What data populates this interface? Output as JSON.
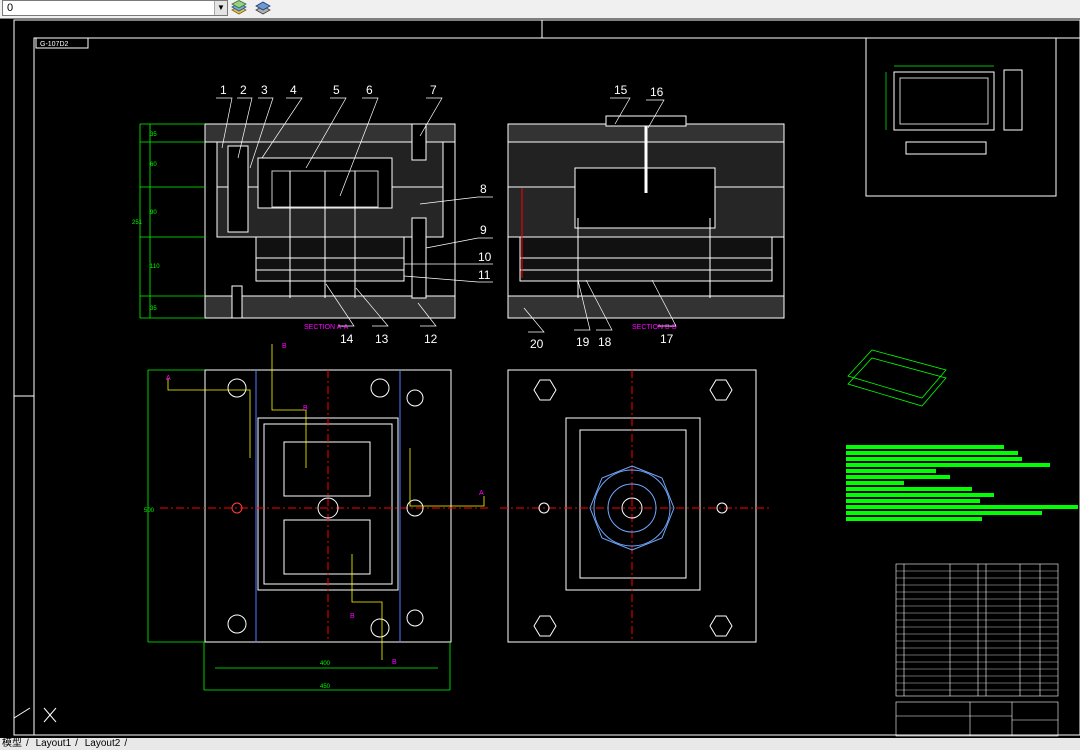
{
  "toolbar": {
    "layer_value": "0",
    "dropdown_arrow": "▼",
    "icons": [
      "layer-states-icon",
      "layer-properties-icon"
    ]
  },
  "drawing": {
    "drawing_number": "G-107D2",
    "section_aa": "SECTION A-A",
    "section_bb": "SECTION B-B",
    "part_callouts": [
      "1",
      "2",
      "3",
      "4",
      "5",
      "6",
      "7",
      "8",
      "9",
      "10",
      "11",
      "12",
      "13",
      "14",
      "15",
      "16",
      "17",
      "18",
      "19",
      "20"
    ],
    "dims_left": [
      "35",
      "60",
      "90",
      "110",
      "35"
    ],
    "dim_total_height": "251",
    "dim_plan_height": "500",
    "dim_width_inner": "400",
    "dim_width_outer": "450",
    "section_marks": [
      "A",
      "A",
      "B",
      "B",
      "B",
      "B"
    ]
  },
  "tabs": {
    "model": "模型",
    "layout1": "Layout1",
    "layout2": "Layout2"
  },
  "colors": {
    "background": "#000000",
    "lines": "#ffffff",
    "green_text": "#00ff00",
    "magenta": "#ff00ff",
    "yellow": "#ffff00",
    "red_center": "#ff0000",
    "cyan": "#00ffff",
    "blue": "#4f7cff"
  }
}
